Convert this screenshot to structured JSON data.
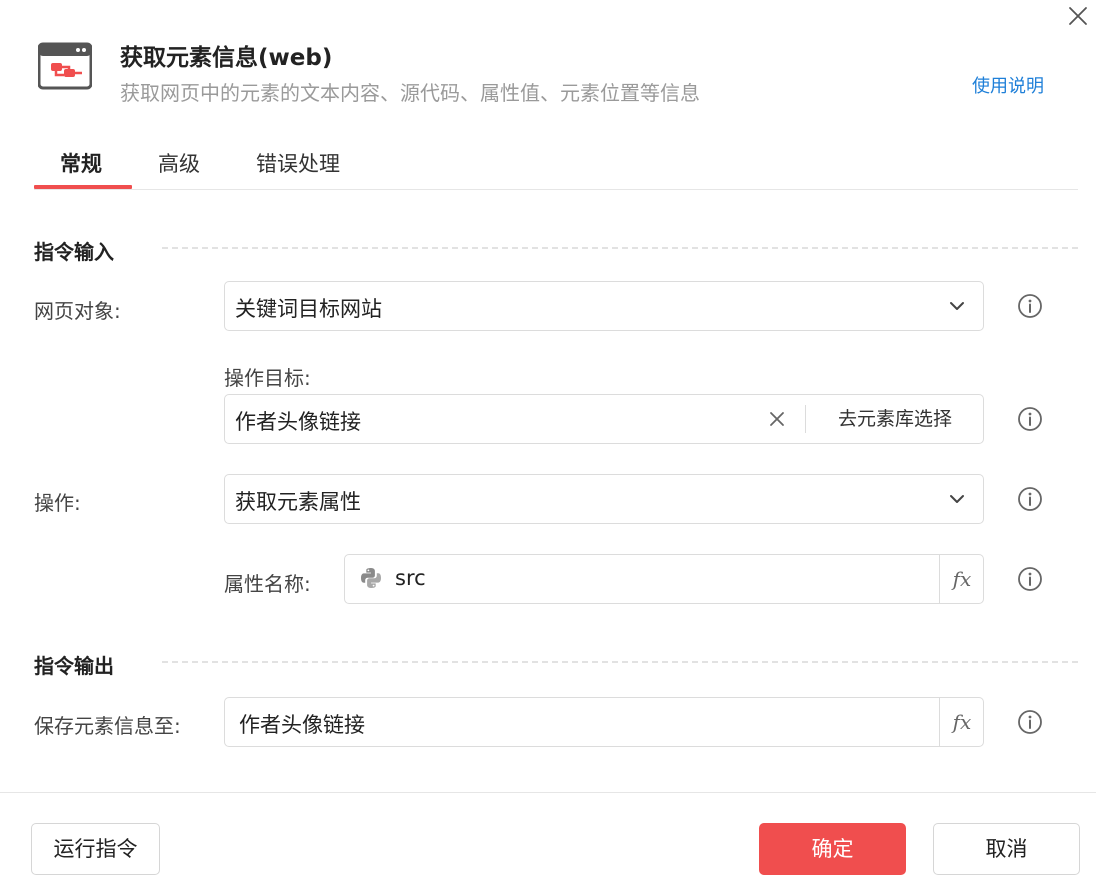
{
  "header": {
    "title": "获取元素信息(web)",
    "subtitle": "获取网页中的元素的文本内容、源代码、属性值、元素位置等信息",
    "help_link": "使用说明",
    "icon": "browser-element-icon",
    "close_icon": "close-icon"
  },
  "tabs": [
    {
      "label": "常规",
      "active": true
    },
    {
      "label": "高级",
      "active": false
    },
    {
      "label": "错误处理",
      "active": false
    }
  ],
  "input_section": {
    "title": "指令输入",
    "webpage_object": {
      "label": "网页对象:",
      "value": "关键词目标网站"
    },
    "operation_target": {
      "label": "操作目标:",
      "value": "作者头像链接",
      "picker_label": "去元素库选择"
    },
    "operation": {
      "label": "操作:",
      "value": "获取元素属性"
    },
    "attribute_name": {
      "label": "属性名称:",
      "value": "src",
      "fx_label": "fx"
    }
  },
  "output_section": {
    "title": "指令输出",
    "save_to": {
      "label": "保存元素信息至:",
      "value": "作者头像链接",
      "fx_label": "fx"
    }
  },
  "footer": {
    "run_label": "运行指令",
    "confirm_label": "确定",
    "cancel_label": "取消"
  },
  "colors": {
    "accent": "#f04e4e",
    "link": "#1e7fd8",
    "muted_text": "#9a9a9a",
    "border": "#dcdcdc"
  }
}
